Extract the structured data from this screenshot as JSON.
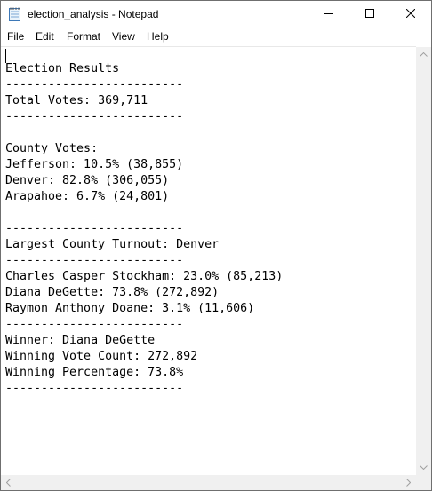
{
  "window": {
    "title": "election_analysis - Notepad",
    "icon": "notepad-icon"
  },
  "menu": {
    "items": [
      {
        "label": "File"
      },
      {
        "label": "Edit"
      },
      {
        "label": "Format"
      },
      {
        "label": "View"
      },
      {
        "label": "Help"
      }
    ]
  },
  "document": {
    "text": "Election Results\n-------------------------\nTotal Votes: 369,711\n-------------------------\n\nCounty Votes:\nJefferson: 10.5% (38,855)\nDenver: 82.8% (306,055)\nArapahoe: 6.7% (24,801)\n\n-------------------------\nLargest County Turnout: Denver\n-------------------------\nCharles Casper Stockham: 23.0% (85,213)\nDiana DeGette: 73.8% (272,892)\nRaymon Anthony Doane: 3.1% (11,606)\n-------------------------\nWinner: Diana DeGette\nWinning Vote Count: 272,892\nWinning Percentage: 73.8%\n-------------------------"
  },
  "icons": {
    "minimize": "minimize-icon",
    "maximize": "maximize-icon",
    "close": "close-icon",
    "scroll_up": "arrow-up-icon",
    "scroll_down": "arrow-down-icon",
    "scroll_left": "arrow-left-icon",
    "scroll_right": "arrow-right-icon"
  },
  "colors": {
    "text": "#000000",
    "background": "#ffffff",
    "scrollbar": "#f0f0f0"
  }
}
